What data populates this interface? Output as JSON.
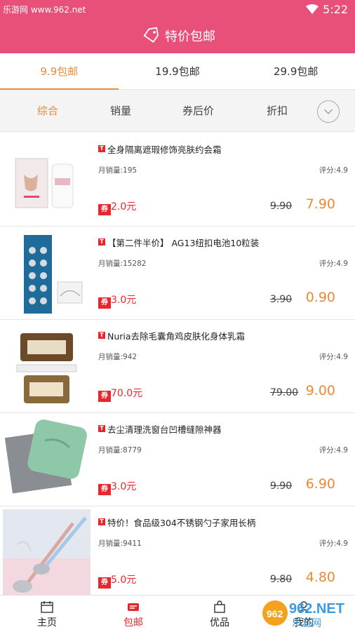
{
  "status_bar": {
    "watermark": "乐游网 www.962.net",
    "time": "5:22"
  },
  "header": {
    "title": "特价包邮"
  },
  "price_tabs": [
    {
      "label": "9.9包邮",
      "active": true
    },
    {
      "label": "19.9包邮",
      "active": false
    },
    {
      "label": "29.9包邮",
      "active": false
    }
  ],
  "sort_options": [
    {
      "label": "综合",
      "active": true
    },
    {
      "label": "销量",
      "active": false
    },
    {
      "label": "券后价",
      "active": false
    },
    {
      "label": "折扣",
      "active": false
    }
  ],
  "products": [
    {
      "name": "全身隔离遮瑕修饰亮肤约会霜",
      "sales": "月销量:195",
      "rating": "评分:4.9",
      "coupon": "2.0元",
      "original_price": "9.90",
      "final_price": "7.90"
    },
    {
      "name": "【第二件半价】 AG13纽扣电池10粒装",
      "sales": "月销量:15282",
      "rating": "评分:4.9",
      "coupon": "3.0元",
      "original_price": "3.90",
      "final_price": "0.90"
    },
    {
      "name": "Nuria去除毛囊角鸡皮肤化身体乳霜",
      "sales": "月销量:942",
      "rating": "评分:4.9",
      "coupon": "70.0元",
      "original_price": "79.00",
      "final_price": "9.00"
    },
    {
      "name": "去尘清理洗窗台凹槽缝隙神器",
      "sales": "月销量:8779",
      "rating": "评分:4.9",
      "coupon": "3.0元",
      "original_price": "9.90",
      "final_price": "6.90"
    },
    {
      "name": "特价！食品级304不锈钢勺子家用长柄",
      "sales": "月销量:9411",
      "rating": "评分:4.9",
      "coupon": "5.0元",
      "original_price": "9.80",
      "final_price": "4.80"
    }
  ],
  "bottom_nav": [
    {
      "label": "主页",
      "icon": "calendar-icon",
      "active": false
    },
    {
      "label": "包邮",
      "icon": "shipping-icon",
      "active": true
    },
    {
      "label": "优品",
      "icon": "bag-icon",
      "active": false
    },
    {
      "label": "我的",
      "icon": "user-icon",
      "active": false
    }
  ],
  "coupon_badge": "券",
  "source_badge": "T",
  "logo_text": "962.NET",
  "logo_subtext": "乐游网",
  "colors": {
    "header": "#e8507a",
    "accent": "#e98a3b",
    "coupon": "#e8262b"
  }
}
